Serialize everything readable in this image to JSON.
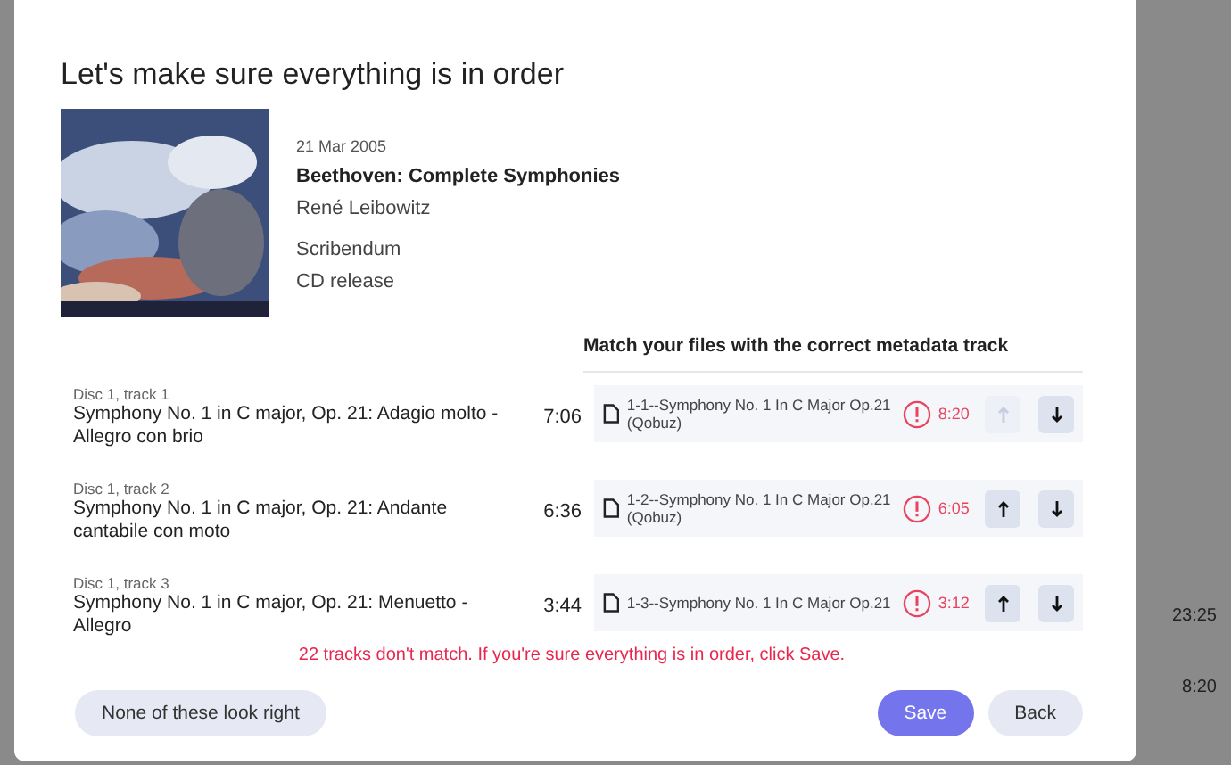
{
  "dialog": {
    "title": "Let's make sure everything is in order",
    "album": {
      "date": "21 Mar 2005",
      "title": "Beethoven: Complete Symphonies",
      "artist": "René Leibowitz",
      "label": "Scribendum",
      "format": "CD release"
    },
    "match_heading": "Match your files with the correct metadata track",
    "tracks": [
      {
        "position": "Disc 1, track 1",
        "title": "Symphony No. 1 in C major, Op. 21: Adagio molto - Allegro con brio",
        "duration": "7:06",
        "file": {
          "name": "1-1--Symphony No. 1 In C Major Op.21 (Qobuz)",
          "mismatch": true,
          "duration": "8:20",
          "up_disabled": true,
          "down_disabled": false
        }
      },
      {
        "position": "Disc 1, track 2",
        "title": "Symphony No. 1 in C major, Op. 21: Andante cantabile con moto",
        "duration": "6:36",
        "file": {
          "name": "1-2--Symphony No. 1 In C Major Op.21 (Qobuz)",
          "mismatch": true,
          "duration": "6:05",
          "up_disabled": false,
          "down_disabled": false
        }
      },
      {
        "position": "Disc 1, track 3",
        "title": "Symphony No. 1 in C major, Op. 21: Menuetto - Allegro",
        "duration": "3:44",
        "file": {
          "name": "1-3--Symphony No. 1 In C Major Op.21",
          "mismatch": true,
          "duration": "3:12",
          "up_disabled": false,
          "down_disabled": false
        }
      }
    ],
    "warning": "22 tracks don't match. If you're sure everything is in order, click Save.",
    "buttons": {
      "left": "None of these look right",
      "primary": "Save",
      "secondary": "Back"
    }
  },
  "background": {
    "times": [
      "23:25",
      "8:20"
    ]
  }
}
